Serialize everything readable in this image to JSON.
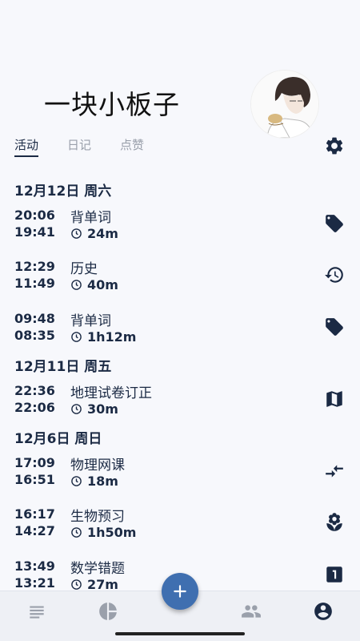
{
  "profile": {
    "username": "一块小板子"
  },
  "tabs": [
    {
      "label": "活动",
      "active": true
    },
    {
      "label": "日记",
      "active": false
    },
    {
      "label": "点赞",
      "active": false
    }
  ],
  "days": [
    {
      "header": "12月12日 周六"
    },
    {
      "header": "12月11日 周五"
    },
    {
      "header": "12月6日 周日"
    }
  ],
  "entries": [
    {
      "end": "20:06",
      "start": "19:41",
      "title": "背单词",
      "duration": "24m",
      "icon": "tag-icon"
    },
    {
      "end": "12:29",
      "start": "11:49",
      "title": "历史",
      "duration": "40m",
      "icon": "history-icon"
    },
    {
      "end": "09:48",
      "start": "08:35",
      "title": "背单词",
      "duration": "1h12m",
      "icon": "tag-icon"
    },
    {
      "end": "22:36",
      "start": "22:06",
      "title": "地理试卷订正",
      "duration": "30m",
      "icon": "map-icon"
    },
    {
      "end": "17:09",
      "start": "16:51",
      "title": "物理网课",
      "duration": "18m",
      "icon": "compare-arrows-icon"
    },
    {
      "end": "16:17",
      "start": "14:27",
      "title": "生物预习",
      "duration": "1h50m",
      "icon": "flower-icon"
    },
    {
      "end": "13:49",
      "start": "13:21",
      "title": "数学错题",
      "duration": "27m",
      "icon": "looks-one-icon"
    }
  ],
  "nav": [
    "list-icon",
    "pie-chart-icon",
    "people-icon",
    "account-icon"
  ],
  "colors": {
    "primary": "#1b2a44",
    "fab": "#3f6fb0",
    "background": "#f7f8fc"
  }
}
